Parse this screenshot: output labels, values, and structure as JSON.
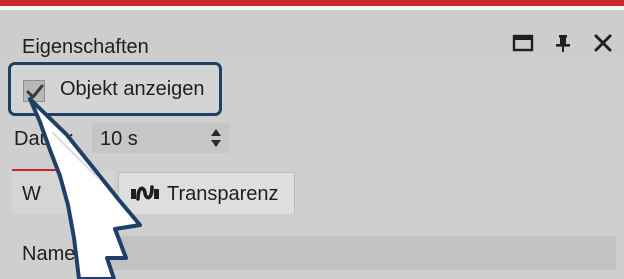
{
  "panel": {
    "title": "Eigenschaften",
    "actions": [
      {
        "icon": "window-icon"
      },
      {
        "icon": "pin-icon"
      },
      {
        "icon": "close-icon"
      }
    ]
  },
  "objekt": {
    "label": "Objekt anzeigen",
    "checked": true
  },
  "dauer": {
    "label": "Dauer:",
    "value": "10 s"
  },
  "tabs": [
    {
      "label": "W"
    },
    {
      "label": "Transparenz",
      "icon": "transparency-icon"
    }
  ],
  "name_field": {
    "label": "Name",
    "value": ""
  },
  "colors": {
    "accent_red": "#c62828",
    "highlight_border": "#1e3f66"
  }
}
